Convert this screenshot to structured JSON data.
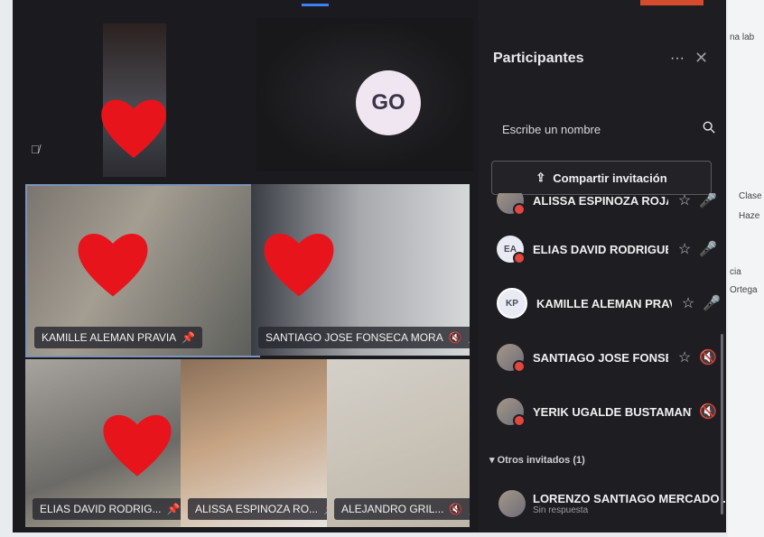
{
  "app": {
    "accent": "#3b82f6"
  },
  "stage": {
    "self_avatar_initials": "GO",
    "tiles": [
      {
        "name": "KAMILLE ALEMAN PRAVIA",
        "pinned": true,
        "muted": false
      },
      {
        "name": "SANTIAGO JOSE FONSECA MORA",
        "pinned": true,
        "muted": true
      },
      {
        "name": "ELIAS DAVID RODRIG...",
        "pinned": true,
        "muted": false
      },
      {
        "name": "ALISSA ESPINOZA RO...",
        "pinned": true,
        "muted": false
      },
      {
        "name": "ALEJANDRO GRIL...",
        "pinned": true,
        "muted": true
      }
    ]
  },
  "panel": {
    "title": "Participantes",
    "more": "···",
    "close": "✕",
    "search_placeholder": "Escribe un nombre",
    "share_label": "Compartir invitación",
    "participants": [
      {
        "initials": "",
        "name": "ALISSA ESPINOZA ROJAS",
        "photo": true,
        "mic": "on"
      },
      {
        "initials": "EA",
        "name": "ELIAS DAVID RODRIGUEZ...",
        "photo": false,
        "mic": "on"
      },
      {
        "initials": "KP",
        "name": "KAMILLE ALEMAN PRAVIA",
        "photo": false,
        "mic": "on"
      },
      {
        "initials": "",
        "name": "SANTIAGO JOSE FONSEC...",
        "photo": true,
        "mic": "off"
      },
      {
        "initials": "",
        "name": "YERIK UGALDE BUSTAMANTE",
        "photo": true,
        "mic": "off"
      }
    ],
    "section_label": "▾ Otros invitados (1)",
    "guest": {
      "name": "LORENZO SANTIAGO MERCADO ...",
      "status": "Sin respuesta"
    }
  },
  "side": {
    "t1": "na lab",
    "t2": "Clase",
    "t3": "Haze",
    "t4": "cia",
    "t5": "Ortega"
  }
}
